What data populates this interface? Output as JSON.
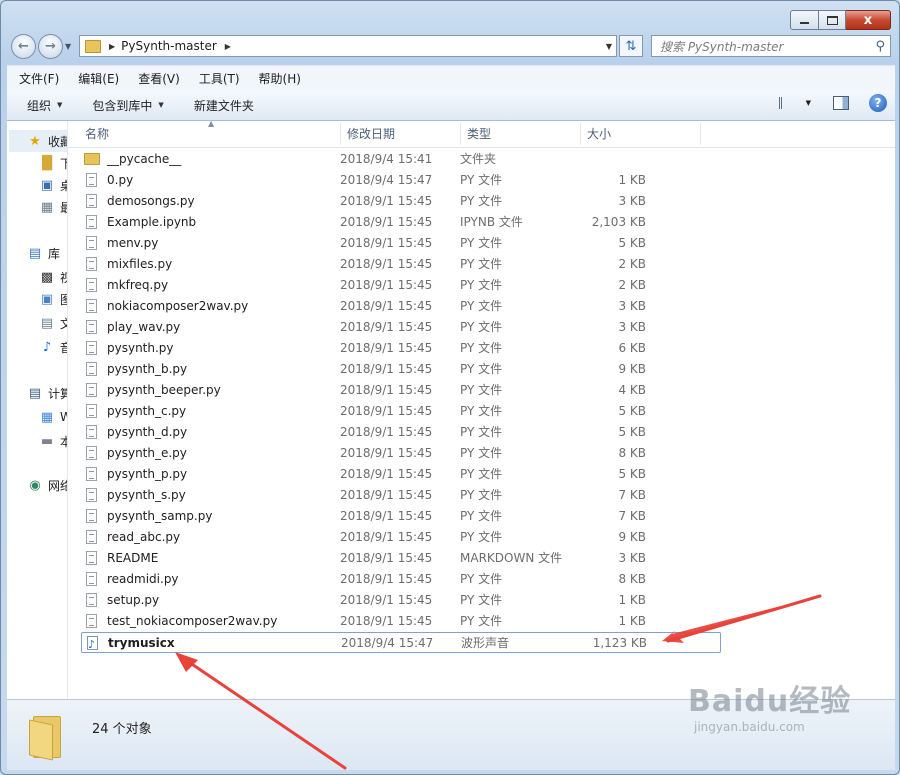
{
  "window": {
    "caption_close": "x"
  },
  "address": {
    "current_folder": "PySynth-master"
  },
  "search": {
    "placeholder": "搜索 PySynth-master"
  },
  "menu": [
    "文件(F)",
    "编辑(E)",
    "查看(V)",
    "工具(T)",
    "帮助(H)"
  ],
  "toolbar": {
    "organize": "组织",
    "include_library": "包含到库中",
    "new_folder": "新建文件夹",
    "help": "?"
  },
  "nav_pane": [
    {
      "label": "收藏夹",
      "icon": "star-icon"
    },
    {
      "label": "下载",
      "icon": "folder-icon"
    },
    {
      "label": "桌面",
      "icon": "desktop-icon"
    },
    {
      "label": "最近访问的位置",
      "icon": "recent-places-icon"
    },
    {
      "label": "库",
      "icon": "library-icon"
    },
    {
      "label": "视频",
      "icon": "video-icon"
    },
    {
      "label": "图片",
      "icon": "pictures-icon"
    },
    {
      "label": "文档",
      "icon": "documents-icon"
    },
    {
      "label": "音乐",
      "icon": "music-icon"
    },
    {
      "label": "计算机",
      "icon": "computer-icon"
    },
    {
      "label": "Windows",
      "icon": "windows-drive-icon"
    },
    {
      "label": "本地磁盘",
      "icon": "drive-icon"
    },
    {
      "label": "网络",
      "icon": "network-icon"
    }
  ],
  "columns": {
    "name": "名称",
    "date": "修改日期",
    "type": "类型",
    "size": "大小"
  },
  "files": [
    {
      "name": "__pycache__",
      "date": "2018/9/4 15:41",
      "type": "文件夹",
      "size": "",
      "kind": "folder"
    },
    {
      "name": "0.py",
      "date": "2018/9/4 15:47",
      "type": "PY 文件",
      "size": "1 KB",
      "kind": "doc"
    },
    {
      "name": "demosongs.py",
      "date": "2018/9/1 15:45",
      "type": "PY 文件",
      "size": "3 KB",
      "kind": "doc"
    },
    {
      "name": "Example.ipynb",
      "date": "2018/9/1 15:45",
      "type": "IPYNB 文件",
      "size": "2,103 KB",
      "kind": "doc"
    },
    {
      "name": "menv.py",
      "date": "2018/9/1 15:45",
      "type": "PY 文件",
      "size": "5 KB",
      "kind": "doc"
    },
    {
      "name": "mixfiles.py",
      "date": "2018/9/1 15:45",
      "type": "PY 文件",
      "size": "2 KB",
      "kind": "doc"
    },
    {
      "name": "mkfreq.py",
      "date": "2018/9/1 15:45",
      "type": "PY 文件",
      "size": "2 KB",
      "kind": "doc"
    },
    {
      "name": "nokiacomposer2wav.py",
      "date": "2018/9/1 15:45",
      "type": "PY 文件",
      "size": "3 KB",
      "kind": "doc"
    },
    {
      "name": "play_wav.py",
      "date": "2018/9/1 15:45",
      "type": "PY 文件",
      "size": "3 KB",
      "kind": "doc"
    },
    {
      "name": "pysynth.py",
      "date": "2018/9/1 15:45",
      "type": "PY 文件",
      "size": "6 KB",
      "kind": "doc"
    },
    {
      "name": "pysynth_b.py",
      "date": "2018/9/1 15:45",
      "type": "PY 文件",
      "size": "9 KB",
      "kind": "doc"
    },
    {
      "name": "pysynth_beeper.py",
      "date": "2018/9/1 15:45",
      "type": "PY 文件",
      "size": "4 KB",
      "kind": "doc"
    },
    {
      "name": "pysynth_c.py",
      "date": "2018/9/1 15:45",
      "type": "PY 文件",
      "size": "5 KB",
      "kind": "doc"
    },
    {
      "name": "pysynth_d.py",
      "date": "2018/9/1 15:45",
      "type": "PY 文件",
      "size": "5 KB",
      "kind": "doc"
    },
    {
      "name": "pysynth_e.py",
      "date": "2018/9/1 15:45",
      "type": "PY 文件",
      "size": "8 KB",
      "kind": "doc"
    },
    {
      "name": "pysynth_p.py",
      "date": "2018/9/1 15:45",
      "type": "PY 文件",
      "size": "5 KB",
      "kind": "doc"
    },
    {
      "name": "pysynth_s.py",
      "date": "2018/9/1 15:45",
      "type": "PY 文件",
      "size": "7 KB",
      "kind": "doc"
    },
    {
      "name": "pysynth_samp.py",
      "date": "2018/9/1 15:45",
      "type": "PY 文件",
      "size": "7 KB",
      "kind": "doc"
    },
    {
      "name": "read_abc.py",
      "date": "2018/9/1 15:45",
      "type": "PY 文件",
      "size": "9 KB",
      "kind": "doc"
    },
    {
      "name": "README",
      "date": "2018/9/1 15:45",
      "type": "MARKDOWN 文件",
      "size": "3 KB",
      "kind": "doc"
    },
    {
      "name": "readmidi.py",
      "date": "2018/9/1 15:45",
      "type": "PY 文件",
      "size": "8 KB",
      "kind": "doc"
    },
    {
      "name": "setup.py",
      "date": "2018/9/1 15:45",
      "type": "PY 文件",
      "size": "1 KB",
      "kind": "doc"
    },
    {
      "name": "test_nokiacomposer2wav.py",
      "date": "2018/9/1 15:45",
      "type": "PY 文件",
      "size": "1 KB",
      "kind": "doc"
    },
    {
      "name": "trymusicx",
      "date": "2018/9/4 15:47",
      "type": "波形声音",
      "size": "1,123 KB",
      "kind": "music",
      "selected": true
    }
  ],
  "status": {
    "count": "24 个对象"
  },
  "watermark": {
    "brand": "Baidu经验",
    "url": "jingyan.baidu.com"
  },
  "colors": {
    "annotation_arrow": "#e8433a",
    "selection_border": "#7da2ce"
  }
}
